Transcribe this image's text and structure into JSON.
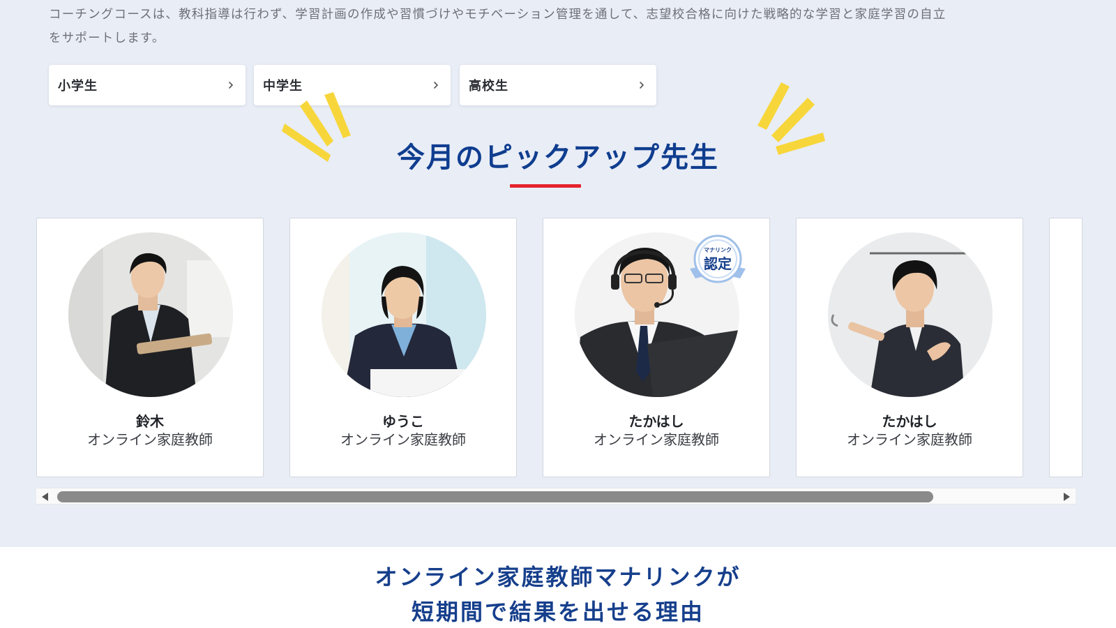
{
  "intro": {
    "line1": "コーチングコースは、教科指導は行わず、学習計画の作成や習慣づけやモチベーション管理を通して、志望校合格に向けた戦略的な学習と家庭学習の自立",
    "line2": "をサポートします。"
  },
  "grades": [
    {
      "label": "小学生",
      "icon": "chevron-right-icon"
    },
    {
      "label": "中学生",
      "icon": "chevron-right-icon"
    },
    {
      "label": "高校生",
      "icon": "chevron-right-icon"
    }
  ],
  "pickup": {
    "title": "今月のピックアップ先生",
    "accent_color": "#e5232c",
    "title_color": "#0f3d8f",
    "deco_color": "#f7d63b"
  },
  "teachers": [
    {
      "name": "鈴木",
      "role": "オンライン家庭教師",
      "photo": "teacher-photo"
    },
    {
      "name": "ゆうこ",
      "role": "オンライン家庭教師",
      "photo": "teacher-photo"
    },
    {
      "name": "たかはし",
      "role": "オンライン家庭教師",
      "photo": "teacher-photo",
      "badge": {
        "small": "マナリンク",
        "main": "認定"
      }
    },
    {
      "name": "たかはし",
      "role": "オンライン家庭教師",
      "photo": "teacher-photo"
    }
  ],
  "scrollbar": {
    "left_icon": "triangle-left-icon",
    "right_icon": "triangle-right-icon"
  },
  "reason": {
    "line1": "オンライン家庭教師マナリンクが",
    "line2": "短期間で結果を出せる理由"
  }
}
